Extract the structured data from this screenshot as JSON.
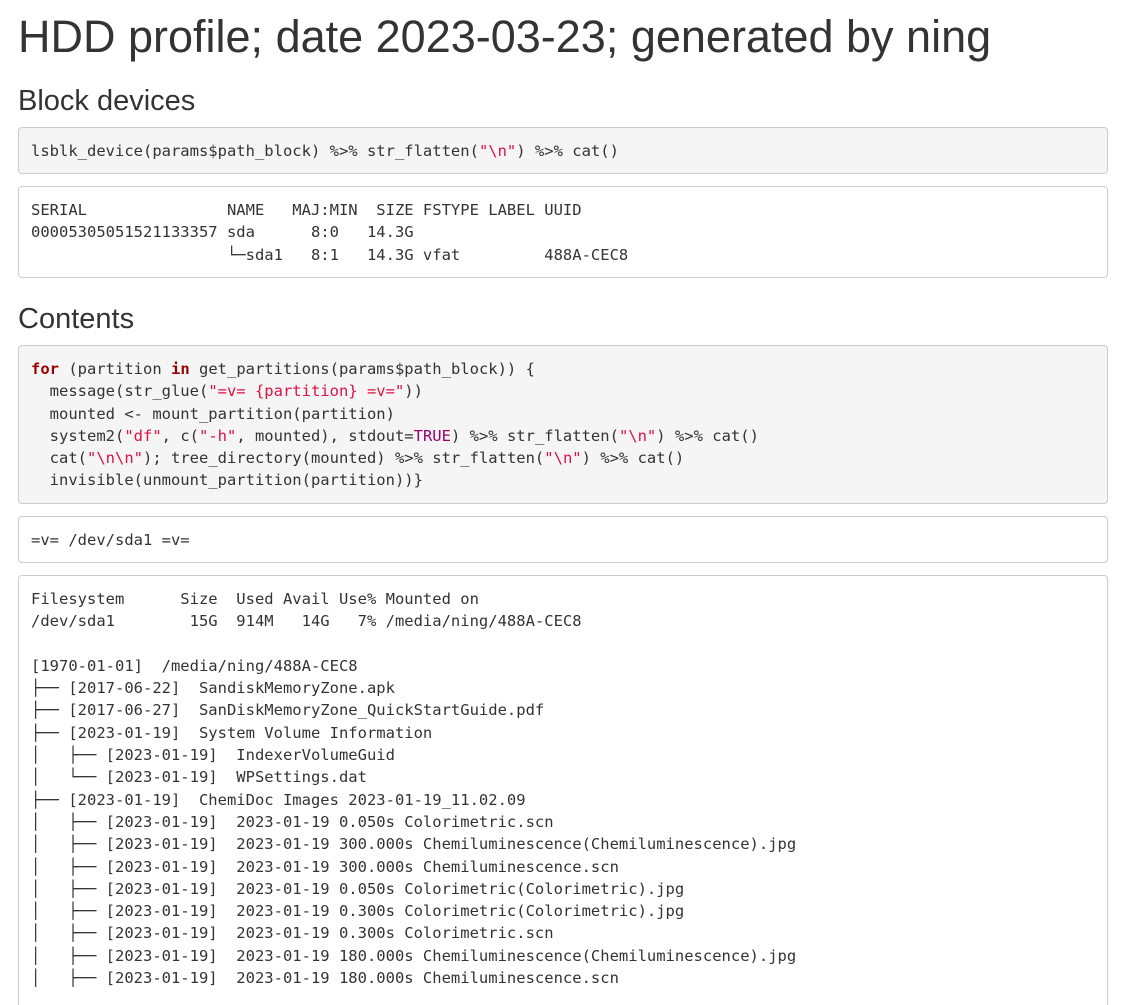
{
  "title": "HDD profile; date 2023-03-23; generated by ning",
  "sections": {
    "block_devices": "Block devices",
    "contents": "Contents"
  },
  "block_code": {
    "seg1": "lsblk_device(params$path_block) %>% str_flatten(",
    "str1": "\"\\n\"",
    "seg2": ") %>% cat()"
  },
  "lsblk_output": [
    "SERIAL               NAME   MAJ:MIN  SIZE FSTYPE LABEL UUID",
    "00005305051521133357 sda      8:0   14.3G",
    "                     └─sda1   8:1   14.3G vfat         488A-CEC8"
  ],
  "contents_code": {
    "l1_kw1": "for",
    "l1_a": " (partition ",
    "l1_kw2": "in",
    "l1_b": " get_partitions(params$path_block)) {",
    "l2_a": "  message(str_glue(",
    "l2_str": "\"=v= {partition} =v=\"",
    "l2_b": "))",
    "l3": "  mounted <- mount_partition(partition)",
    "l4_a": "  system2(",
    "l4_str1": "\"df\"",
    "l4_b": ", c(",
    "l4_str2": "\"-h\"",
    "l4_c": ", mounted), stdout=",
    "l4_const": "TRUE",
    "l4_d": ") %>% str_flatten(",
    "l4_str3": "\"\\n\"",
    "l4_e": ") %>% cat()",
    "l5_a": "  cat(",
    "l5_str1": "\"\\n\\n\"",
    "l5_b": "); tree_directory(mounted) %>% str_flatten(",
    "l5_str2": "\"\\n\"",
    "l5_c": ") %>% cat()",
    "l6": "  invisible(unmount_partition(partition))}"
  },
  "message_output": "=v= /dev/sda1 =v=",
  "df_output": [
    "Filesystem      Size  Used Avail Use% Mounted on",
    "/dev/sda1        15G  914M   14G   7% /media/ning/488A-CEC8",
    "",
    "[1970-01-01]  /media/ning/488A-CEC8",
    "├── [2017-06-22]  SandiskMemoryZone.apk",
    "├── [2017-06-27]  SanDiskMemoryZone_QuickStartGuide.pdf",
    "├── [2023-01-19]  System Volume Information",
    "│   ├── [2023-01-19]  IndexerVolumeGuid",
    "│   └── [2023-01-19]  WPSettings.dat",
    "├── [2023-01-19]  ChemiDoc Images 2023-01-19_11.02.09",
    "│   ├── [2023-01-19]  2023-01-19 0.050s Colorimetric.scn",
    "│   ├── [2023-01-19]  2023-01-19 300.000s Chemiluminescence(Chemiluminescence).jpg",
    "│   ├── [2023-01-19]  2023-01-19 300.000s Chemiluminescence.scn",
    "│   ├── [2023-01-19]  2023-01-19 0.050s Colorimetric(Colorimetric).jpg",
    "│   ├── [2023-01-19]  2023-01-19 0.300s Colorimetric(Colorimetric).jpg",
    "│   ├── [2023-01-19]  2023-01-19 0.300s Colorimetric.scn",
    "│   ├── [2023-01-19]  2023-01-19 180.000s Chemiluminescence(Chemiluminescence).jpg",
    "│   ├── [2023-01-19]  2023-01-19 180.000s Chemiluminescence.scn"
  ]
}
